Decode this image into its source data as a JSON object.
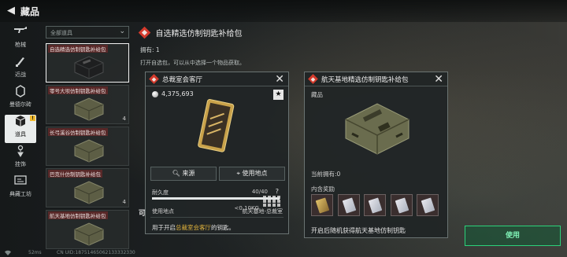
{
  "header": {
    "title": "藏品",
    "back_icon": "back-arrow-icon"
  },
  "nav": [
    {
      "label": "枪械",
      "icon": "rifle-icon"
    },
    {
      "label": "近战",
      "icon": "knife-icon"
    },
    {
      "label": "曼德尔砖",
      "icon": "brick-icon"
    },
    {
      "label": "道具",
      "icon": "cube-icon",
      "badge": "!"
    },
    {
      "label": "挂饰",
      "icon": "charm-icon"
    },
    {
      "label": "典藏工坊",
      "icon": "workshop-icon"
    }
  ],
  "filter": {
    "value": "全部道具"
  },
  "items": [
    {
      "name": "自选精选仿制钥匙补给包",
      "qty": ""
    },
    {
      "name": "零号大坝仿制钥匙补给包",
      "qty": "4"
    },
    {
      "name": "长弓溪谷仿制钥匙补给包",
      "qty": ""
    },
    {
      "name": "巴克什仿制钥匙补给包",
      "qty": "4"
    },
    {
      "name": "航天基地仿制钥匙补给包",
      "qty": ""
    }
  ],
  "detail": {
    "title": "自选精选仿制钥匙补给包",
    "owned": "拥有: 1",
    "description": "打开自选包，可以从中选择一个物品获取。",
    "section_label": "可"
  },
  "popup_a": {
    "title": "总裁室会客厅",
    "price": "4,375,693",
    "weight": "<0.10KG",
    "source_button": "来源",
    "use_location_button": "使用地点",
    "durability_label": "耐久度",
    "durability_value": "40/40",
    "durability_fraction": 1.0,
    "use_location_label": "使用地点",
    "use_location_value": "航天基地-总裁室",
    "use_prefix": "用于开启",
    "use_highlight": "总裁室会客厅",
    "use_suffix": "的钥匙。",
    "star": "★",
    "help": "?"
  },
  "popup_b": {
    "title": "航天基地精选仿制钥匙补给包",
    "subtitle": "藏品",
    "owned": "当前拥有:0",
    "rewards_label": "内含奖励",
    "bottom_text": "开启后随机获得航天基地仿制钥匙"
  },
  "use_button": {
    "label": "使用"
  },
  "status": {
    "ping": "52ms",
    "uid": "CN UID:18751465062133332330"
  },
  "colors": {
    "accent_red": "#d43a2c",
    "use_green": "#2bd27a",
    "highlight": "#e0b23c"
  }
}
